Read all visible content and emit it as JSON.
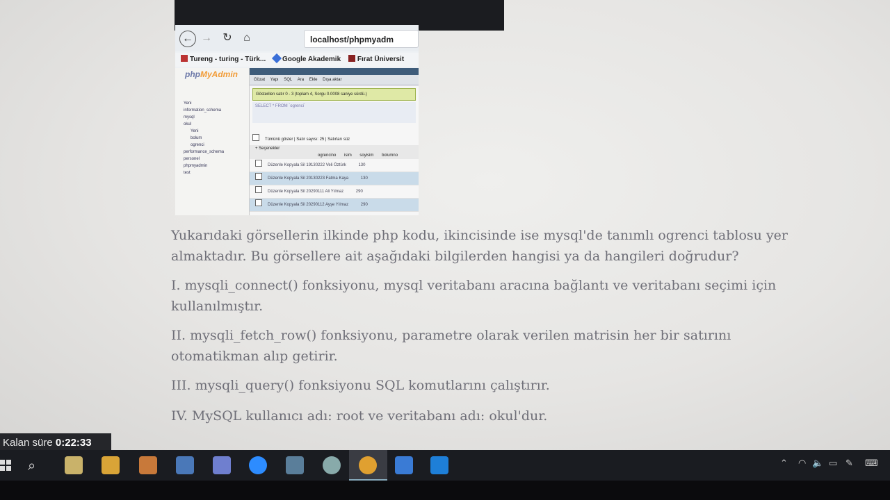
{
  "embedded_screenshot": {
    "url": "localhost/phpmyadm",
    "bookmarks": [
      "Tureng - turing - Türk...",
      "Google Akademik",
      "Fırat Üniversit"
    ],
    "pma_logo": {
      "php": "php",
      "myadmin": "MyAdmin"
    },
    "sidebar_items": [
      "Yeni",
      "information_schema",
      "mysql",
      "okul",
      "Yeni",
      "bolum",
      "ogrenci",
      "performance_schema",
      "personel",
      "phpmyadmin",
      "test"
    ],
    "tabs": [
      "Gözat",
      "Yapı",
      "SQL",
      "Ara",
      "Ekle",
      "Dışa aktar"
    ],
    "success_message": "Gösterilen satır 0 - 3 (toplam 4, Sorgu 0.0008 saniye sürdü.)",
    "sql_preview": "SELECT * FROM `ogrenci`",
    "filter_label": "Tümünü göster | Satır sayısı: 25 | Satırları süz",
    "options_label": "+ Seçenekler",
    "column_headers": [
      "ogrencino",
      "isim",
      "soyisim",
      "bolumno"
    ],
    "rows": [
      {
        "actions": "Düzenle  Kopyala  Sil",
        "no": "19130222",
        "name": "Veli",
        "surname": "Öztürk",
        "dept": "130"
      },
      {
        "actions": "Düzenle  Kopyala  Sil",
        "no": "20130223",
        "name": "Fatma",
        "surname": "Kaya",
        "dept": "130"
      },
      {
        "actions": "Düzenle  Kopyala  Sil",
        "no": "20290111",
        "name": "Ali",
        "surname": "Yılmaz",
        "dept": "290"
      },
      {
        "actions": "Düzenle  Kopyala  Sil",
        "no": "20290112",
        "name": "Ayşe",
        "surname": "Yılmaz",
        "dept": "290"
      }
    ]
  },
  "question": {
    "intro": "Yukarıdaki görsellerin ilkinde php kodu, ikincisinde ise mysql'de tanımlı ogrenci tablosu yer almaktadır. Bu görsellere ait aşağıdaki bilgilerden hangisi ya da hangileri doğrudur?",
    "item1": "I. mysqli_connect() fonksiyonu, mysql veritabanı aracına bağlantı ve veritabanı seçimi için kullanılmıştır.",
    "item2": "II. mysqli_fetch_row() fonksiyonu, parametre olarak verilen matrisin her bir satırını otomatikman alıp getirir.",
    "item3": "III. mysqli_query() fonksiyonu SQL komutlarını çalıştırır.",
    "item4": "IV. MySQL kullanıcı adı: root ve veritabanı adı: okul'dur."
  },
  "timer": {
    "label": "Kalan süre",
    "value": "0:22:33"
  },
  "taskbar": {
    "icons": [
      "windows-start-icon",
      "search-icon",
      "notepad-icon",
      "file-explorer-icon",
      "office-icon",
      "ide-icon",
      "discord-icon",
      "zoom-icon",
      "photos-icon",
      "maps-icon",
      "chrome-icon",
      "note-app-icon",
      "teamviewer-icon"
    ],
    "colors": {
      "chrome": "#e0a030",
      "zoom": "#2d8cff",
      "teamviewer": "#1e7fd8",
      "note": "#3a7bd5"
    }
  }
}
